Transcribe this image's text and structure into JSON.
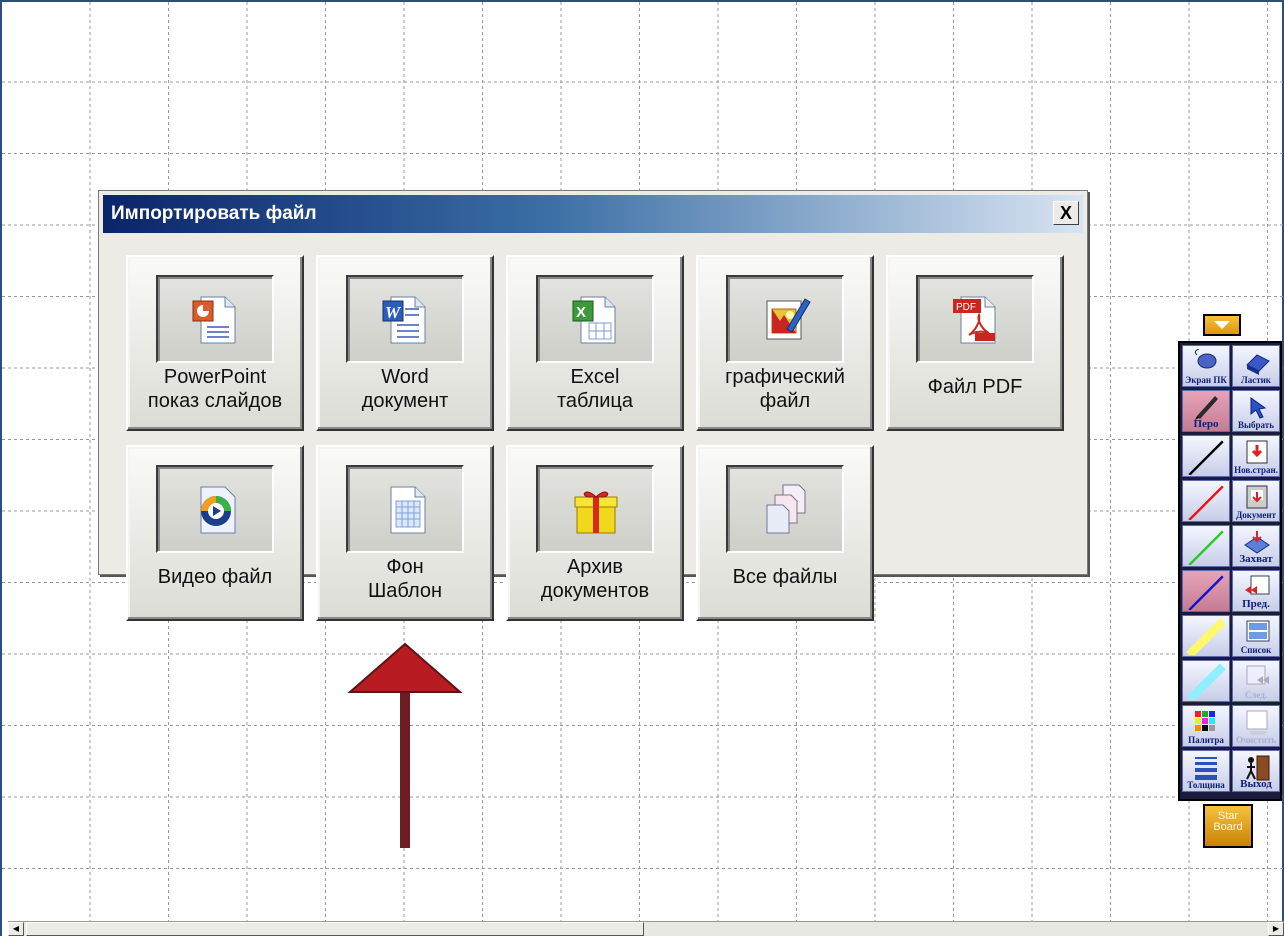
{
  "dialog": {
    "title": "Импортировать файл",
    "close_label": "X",
    "buttons": [
      {
        "id": "powerpoint",
        "line1": "PowerPoint",
        "line2": "показ слайдов",
        "icon": "powerpoint-icon"
      },
      {
        "id": "word",
        "line1": "Word",
        "line2": "документ",
        "icon": "word-icon"
      },
      {
        "id": "excel",
        "line1": "Excel",
        "line2": "таблица",
        "icon": "excel-icon"
      },
      {
        "id": "image",
        "line1": "графический",
        "line2": "файл",
        "icon": "image-file-icon"
      },
      {
        "id": "pdf",
        "line1": "Файл PDF",
        "line2": "",
        "icon": "pdf-icon"
      },
      {
        "id": "video",
        "line1": "Видео файл",
        "line2": "",
        "icon": "video-icon"
      },
      {
        "id": "template",
        "line1": "Фон",
        "line2": "Шаблон",
        "icon": "template-icon"
      },
      {
        "id": "archive",
        "line1": "Архив",
        "line2": "документов",
        "icon": "gift-archive-icon"
      },
      {
        "id": "allfiles",
        "line1": "Все файлы",
        "line2": "",
        "icon": "all-files-icon"
      }
    ]
  },
  "toolbar": {
    "left": [
      {
        "label": "Экран ПК",
        "icon": "mouse-icon"
      },
      {
        "label": "Перо",
        "icon": "pen-icon",
        "selected": true
      },
      {
        "label": "",
        "icon": "black-line-icon"
      },
      {
        "label": "",
        "icon": "red-line-icon"
      },
      {
        "label": "",
        "icon": "green-line-icon"
      },
      {
        "label": "",
        "icon": "blue-line-icon",
        "selected": true
      },
      {
        "label": "",
        "icon": "yellow-marker-icon"
      },
      {
        "label": "",
        "icon": "cyan-marker-icon"
      },
      {
        "label": "Палитра",
        "icon": "palette-icon"
      },
      {
        "label": "Толщина",
        "icon": "thickness-icon"
      }
    ],
    "right": [
      {
        "label": "Ластик",
        "icon": "eraser-icon"
      },
      {
        "label": "Выбрать",
        "icon": "select-arrow-icon"
      },
      {
        "label": "Нов.стран.",
        "icon": "new-page-icon"
      },
      {
        "label": "Документ",
        "icon": "document-icon"
      },
      {
        "label": "Захват",
        "icon": "capture-icon"
      },
      {
        "label": "Пред.",
        "icon": "prev-page-icon"
      },
      {
        "label": "Список",
        "icon": "list-icon"
      },
      {
        "label": "След.",
        "icon": "next-page-icon",
        "disabled": true
      },
      {
        "label": "Очистить",
        "icon": "clear-icon",
        "disabled": true
      },
      {
        "label": "Выход",
        "icon": "exit-icon"
      }
    ],
    "starboard_line1": "Star",
    "starboard_line2": "Board"
  },
  "colors": {
    "accent_arrow": "#b81c22",
    "arrow_shaft": "#6e1d24",
    "titlebar": "#0a246a"
  }
}
